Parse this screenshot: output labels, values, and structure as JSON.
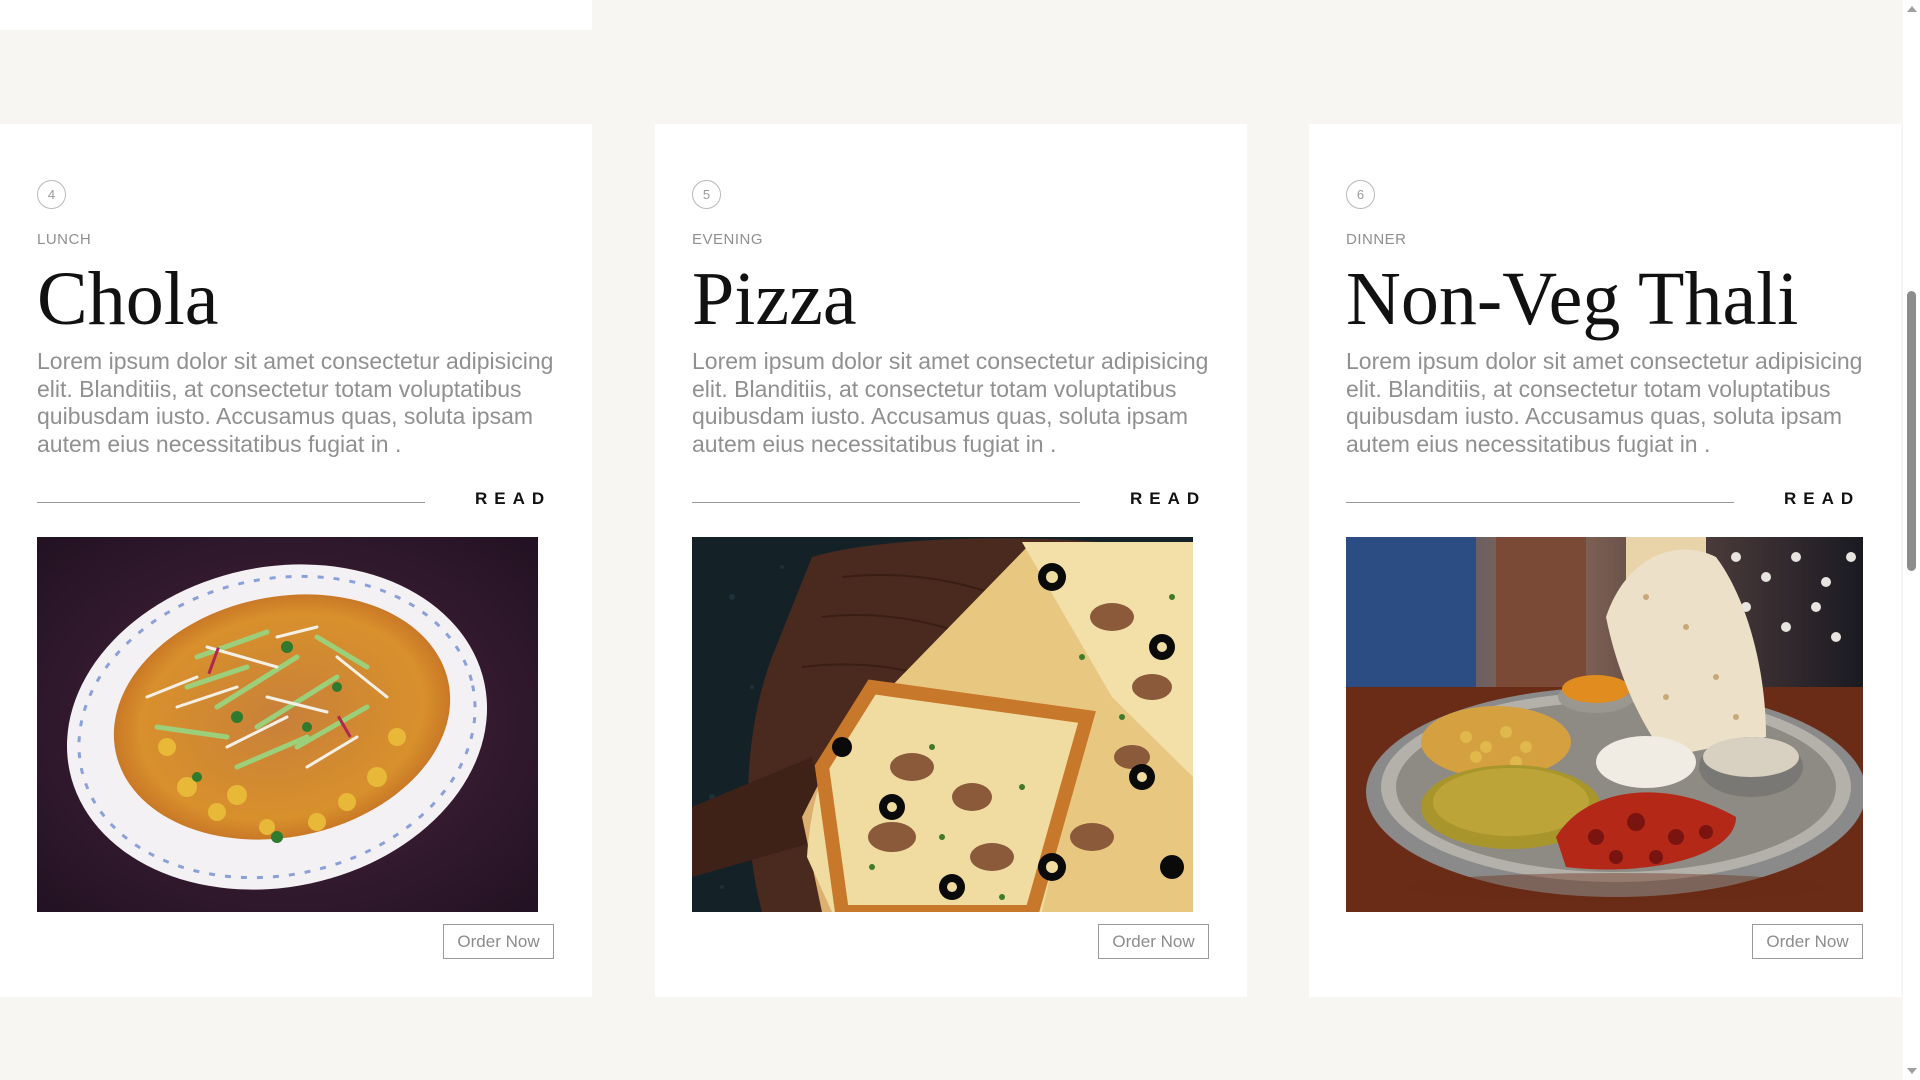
{
  "cards": [
    {
      "number": "4",
      "meal_type": "LUNCH",
      "title": "Chola",
      "description": "Lorem ipsum dolor sit amet consectetur adipisicing elit. Blanditiis, at consectetur totam voluptatibus quibusdam iusto. Accusamus quas, soluta ipsam autem eius necessitatibus fugiat in .",
      "read_label": "READ",
      "order_label": "Order Now"
    },
    {
      "number": "5",
      "meal_type": "EVENING",
      "title": "Pizza",
      "description": "Lorem ipsum dolor sit amet consectetur adipisicing elit. Blanditiis, at consectetur totam voluptatibus quibusdam iusto. Accusamus quas, soluta ipsam autem eius necessitatibus fugiat in .",
      "read_label": "READ",
      "order_label": "Order Now"
    },
    {
      "number": "6",
      "meal_type": "DINNER",
      "title": "Non-Veg Thali",
      "description": "Lorem ipsum dolor sit amet consectetur adipisicing elit. Blanditiis, at consectetur totam voluptatibus quibusdam iusto. Accusamus quas, soluta ipsam autem eius necessitatibus fugiat in .",
      "read_label": "READ",
      "order_label": "Order Now"
    }
  ],
  "colors": {
    "page_background": "#f8f6f2",
    "card_background": "#ffffff",
    "muted_text": "#909090",
    "title_text": "#111111"
  },
  "scrollbar": {
    "up_icon": "arrow-up-icon",
    "down_icon": "arrow-down-icon"
  }
}
